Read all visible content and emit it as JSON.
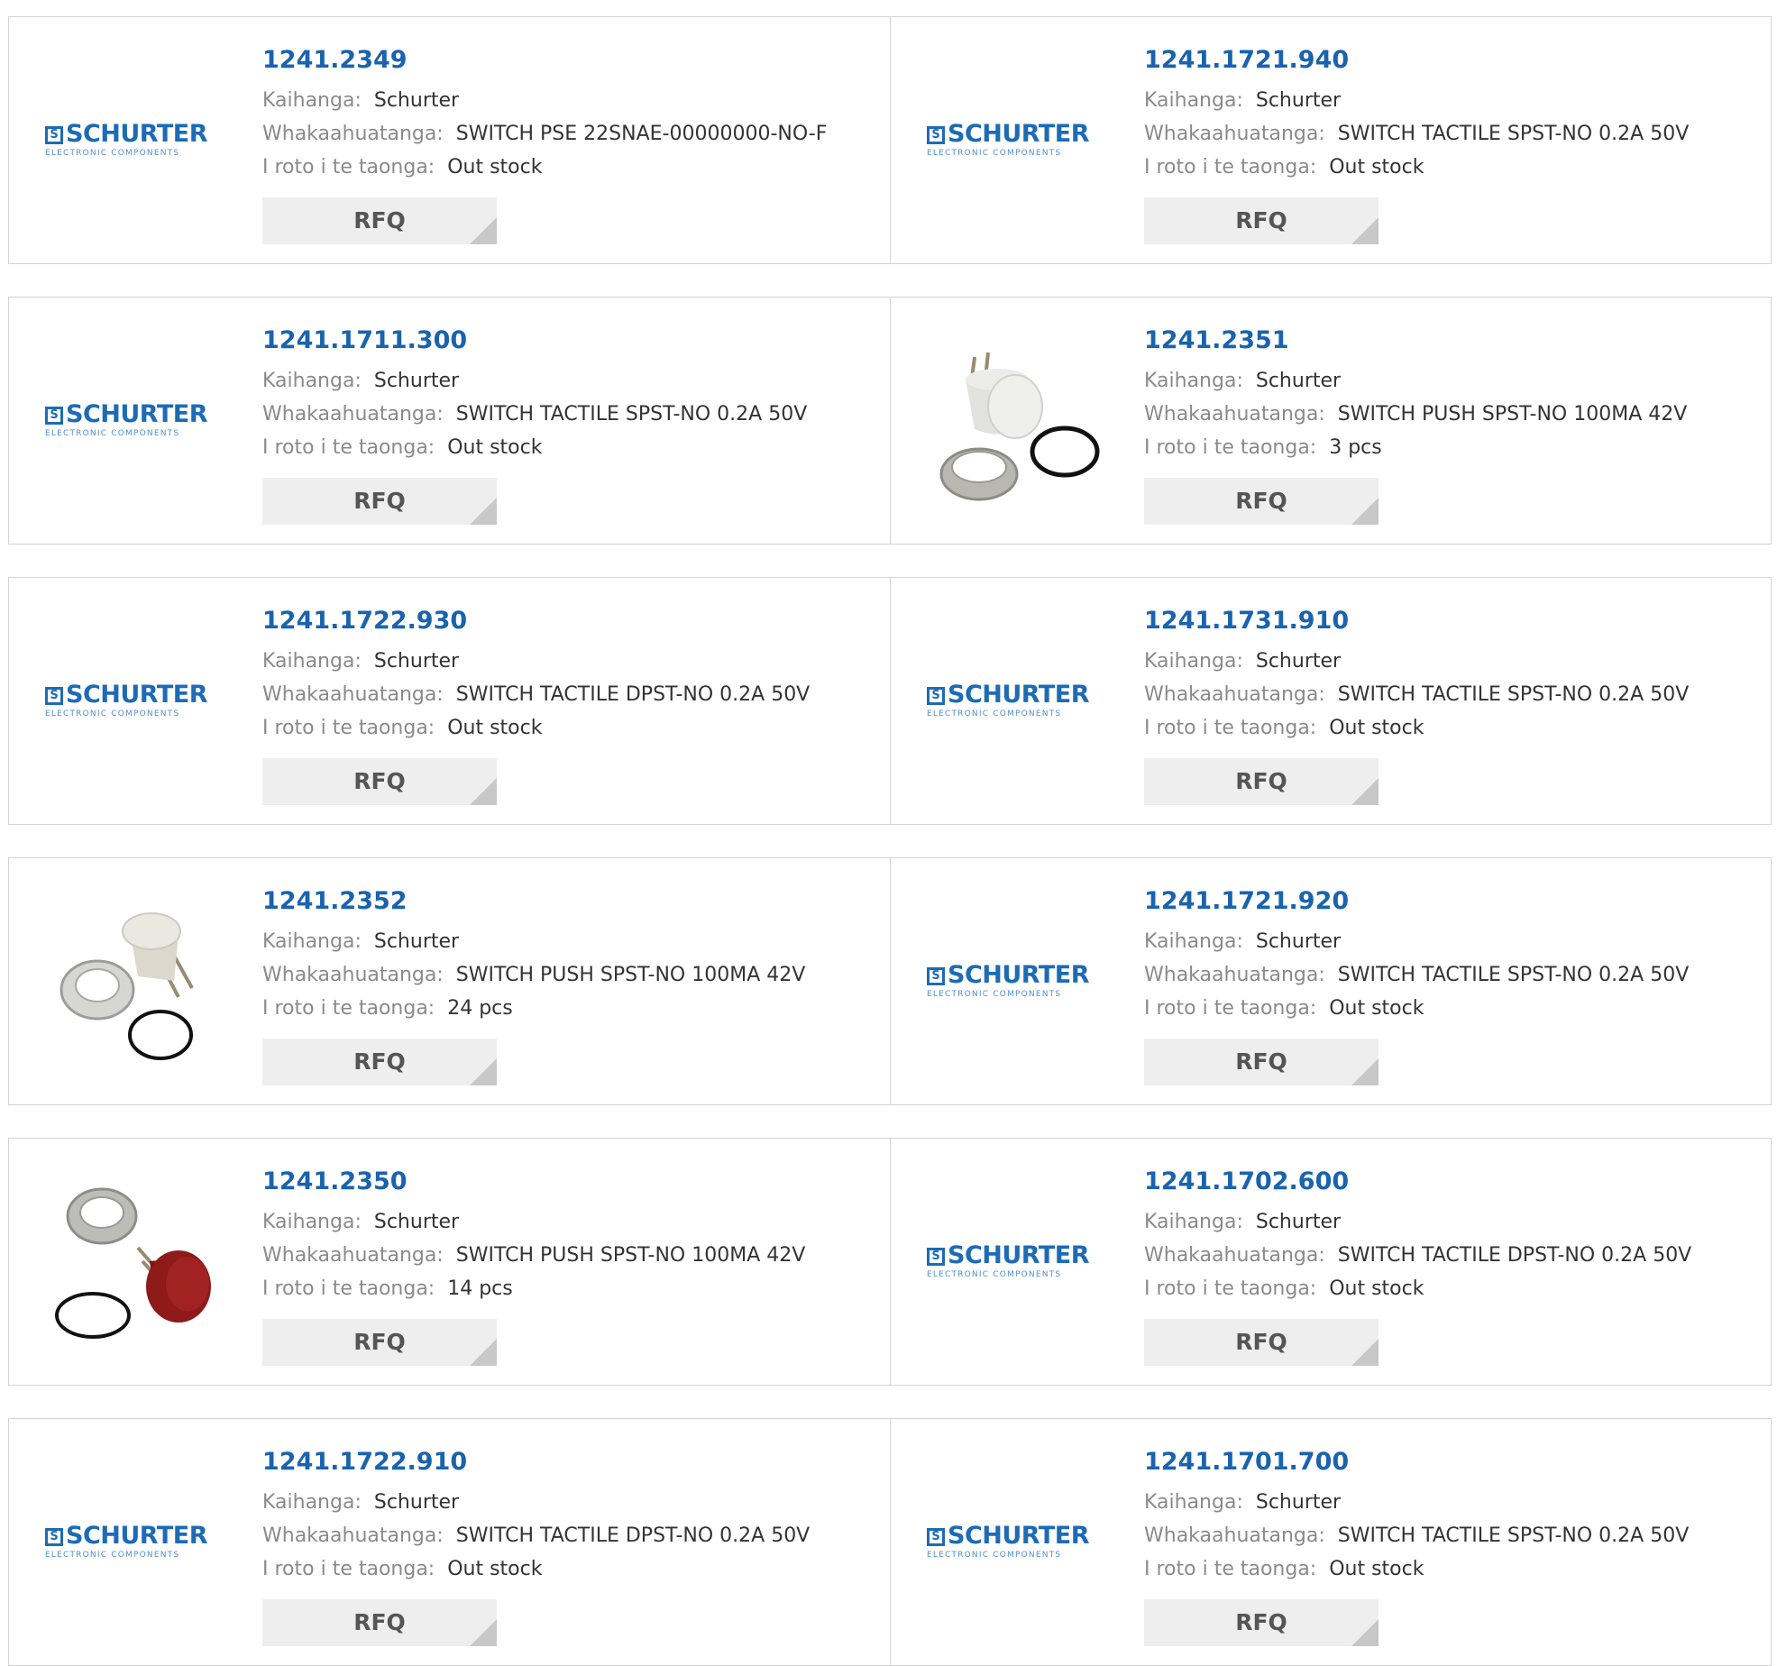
{
  "labels": {
    "manufacturer": "Kaihanga:",
    "description": "Whakaahuatanga:",
    "stock": "I roto i te taonga:",
    "rfq": "RFQ"
  },
  "logo": {
    "mark": "S",
    "name": "SCHURTER",
    "sub": "ELECTRONIC COMPONENTS"
  },
  "products": [
    {
      "part": "1241.2349",
      "manufacturer": "Schurter",
      "description": "SWITCH PSE 22SNAE-00000000-NO-F",
      "stock": "Out stock",
      "image": "schurter-logo"
    },
    {
      "part": "1241.1721.940",
      "manufacturer": "Schurter",
      "description": "SWITCH TACTILE SPST-NO 0.2A 50V",
      "stock": "Out stock",
      "image": "schurter-logo"
    },
    {
      "part": "1241.1711.300",
      "manufacturer": "Schurter",
      "description": "SWITCH TACTILE SPST-NO 0.2A 50V",
      "stock": "Out stock",
      "image": "schurter-logo"
    },
    {
      "part": "1241.2351",
      "manufacturer": "Schurter",
      "description": "SWITCH PUSH SPST-NO 100MA 42V",
      "stock": "3 pcs",
      "image": "push-switch-white"
    },
    {
      "part": "1241.1722.930",
      "manufacturer": "Schurter",
      "description": "SWITCH TACTILE DPST-NO 0.2A 50V",
      "stock": "Out stock",
      "image": "schurter-logo"
    },
    {
      "part": "1241.1731.910",
      "manufacturer": "Schurter",
      "description": "SWITCH TACTILE SPST-NO 0.2A 50V",
      "stock": "Out stock",
      "image": "schurter-logo"
    },
    {
      "part": "1241.2352",
      "manufacturer": "Schurter",
      "description": "SWITCH PUSH SPST-NO 100MA 42V",
      "stock": "24 pcs",
      "image": "push-switch-beige"
    },
    {
      "part": "1241.1721.920",
      "manufacturer": "Schurter",
      "description": "SWITCH TACTILE SPST-NO 0.2A 50V",
      "stock": "Out stock",
      "image": "schurter-logo"
    },
    {
      "part": "1241.2350",
      "manufacturer": "Schurter",
      "description": "SWITCH PUSH SPST-NO 100MA 42V",
      "stock": "14 pcs",
      "image": "push-switch-red"
    },
    {
      "part": "1241.1702.600",
      "manufacturer": "Schurter",
      "description": "SWITCH TACTILE DPST-NO 0.2A 50V",
      "stock": "Out stock",
      "image": "schurter-logo"
    },
    {
      "part": "1241.1722.910",
      "manufacturer": "Schurter",
      "description": "SWITCH TACTILE DPST-NO 0.2A 50V",
      "stock": "Out stock",
      "image": "schurter-logo"
    },
    {
      "part": "1241.1701.700",
      "manufacturer": "Schurter",
      "description": "SWITCH TACTILE SPST-NO 0.2A 50V",
      "stock": "Out stock",
      "image": "schurter-logo"
    }
  ]
}
